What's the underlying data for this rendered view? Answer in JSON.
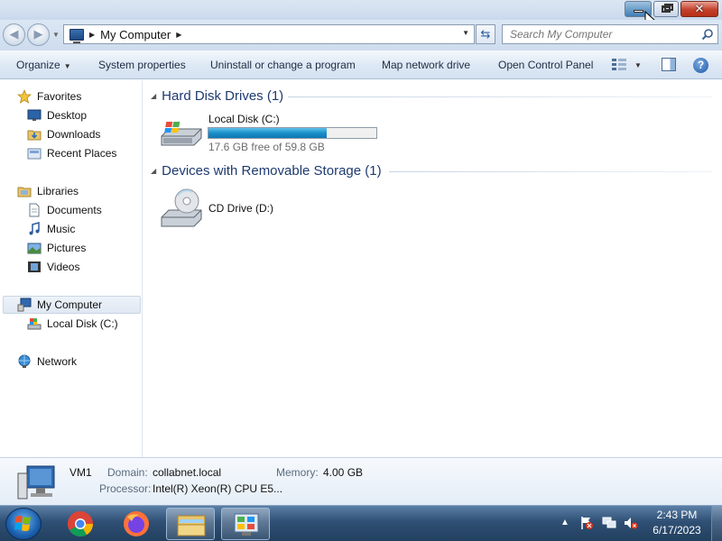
{
  "address_bar": {
    "path": "My Computer",
    "search_placeholder": "Search My Computer"
  },
  "toolbar": {
    "organize": "Organize",
    "system_properties": "System properties",
    "uninstall": "Uninstall or change a program",
    "map_network": "Map network drive",
    "open_control_panel": "Open Control Panel"
  },
  "nav": {
    "favorites": "Favorites",
    "desktop": "Desktop",
    "downloads": "Downloads",
    "recent_places": "Recent Places",
    "libraries": "Libraries",
    "documents": "Documents",
    "music": "Music",
    "pictures": "Pictures",
    "videos": "Videos",
    "my_computer": "My Computer",
    "local_disk": "Local Disk (C:)",
    "network": "Network"
  },
  "content": {
    "hdd_group": "Hard Disk Drives (1)",
    "removable_group": "Devices with Removable Storage (1)",
    "local_disk": {
      "label": "Local Disk (C:)",
      "free_text": "17.6 GB free of 59.8 GB",
      "used_fraction": 0.706
    },
    "cd_drive": {
      "label": "CD Drive (D:)"
    }
  },
  "details": {
    "name": "VM1",
    "domain_key": "Domain:",
    "domain_val": "collabnet.local",
    "memory_key": "Memory:",
    "memory_val": "4.00 GB",
    "processor_key": "Processor:",
    "processor_val": "Intel(R) Xeon(R) CPU E5..."
  },
  "taskbar": {
    "time": "2:43 PM",
    "date": "6/17/2023"
  },
  "colors": {
    "accent": "#1a8fc9",
    "group_title": "#1e3a70"
  }
}
